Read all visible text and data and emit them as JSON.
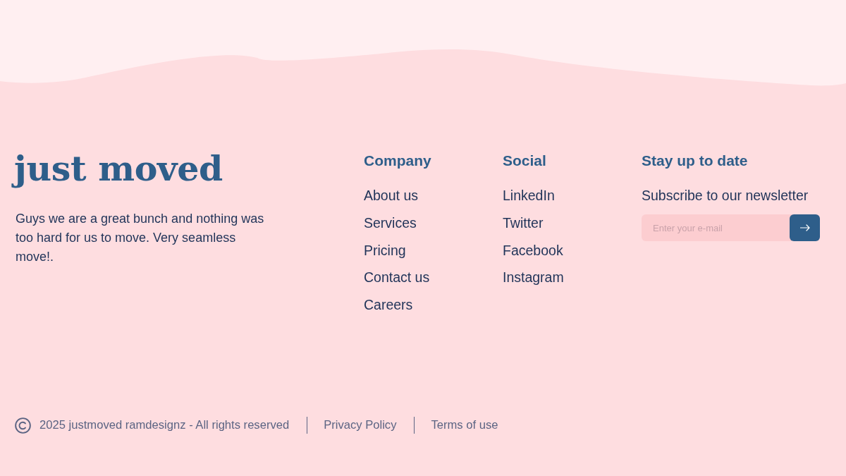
{
  "logo": {
    "text": "just moved"
  },
  "description": "Guys we are a great bunch and nothing was too hard for us to move. Very seamless move!.",
  "columns": [
    {
      "heading": "Company",
      "links": [
        "About us",
        "Services",
        "Pricing",
        "Contact us",
        "Careers"
      ]
    },
    {
      "heading": "Social",
      "links": [
        "LinkedIn",
        "Twitter",
        "Facebook",
        "Instagram"
      ]
    }
  ],
  "newsletter": {
    "heading": "Stay up to date",
    "text": "Subscribe to our newsletter",
    "email_field": {
      "placeholder": "Enter your e-mail"
    }
  },
  "footer_bar": {
    "copyright": "2025 justmoved ramdesignz - All rights reserved",
    "links": [
      "Privacy Policy",
      "Terms of use"
    ]
  }
}
